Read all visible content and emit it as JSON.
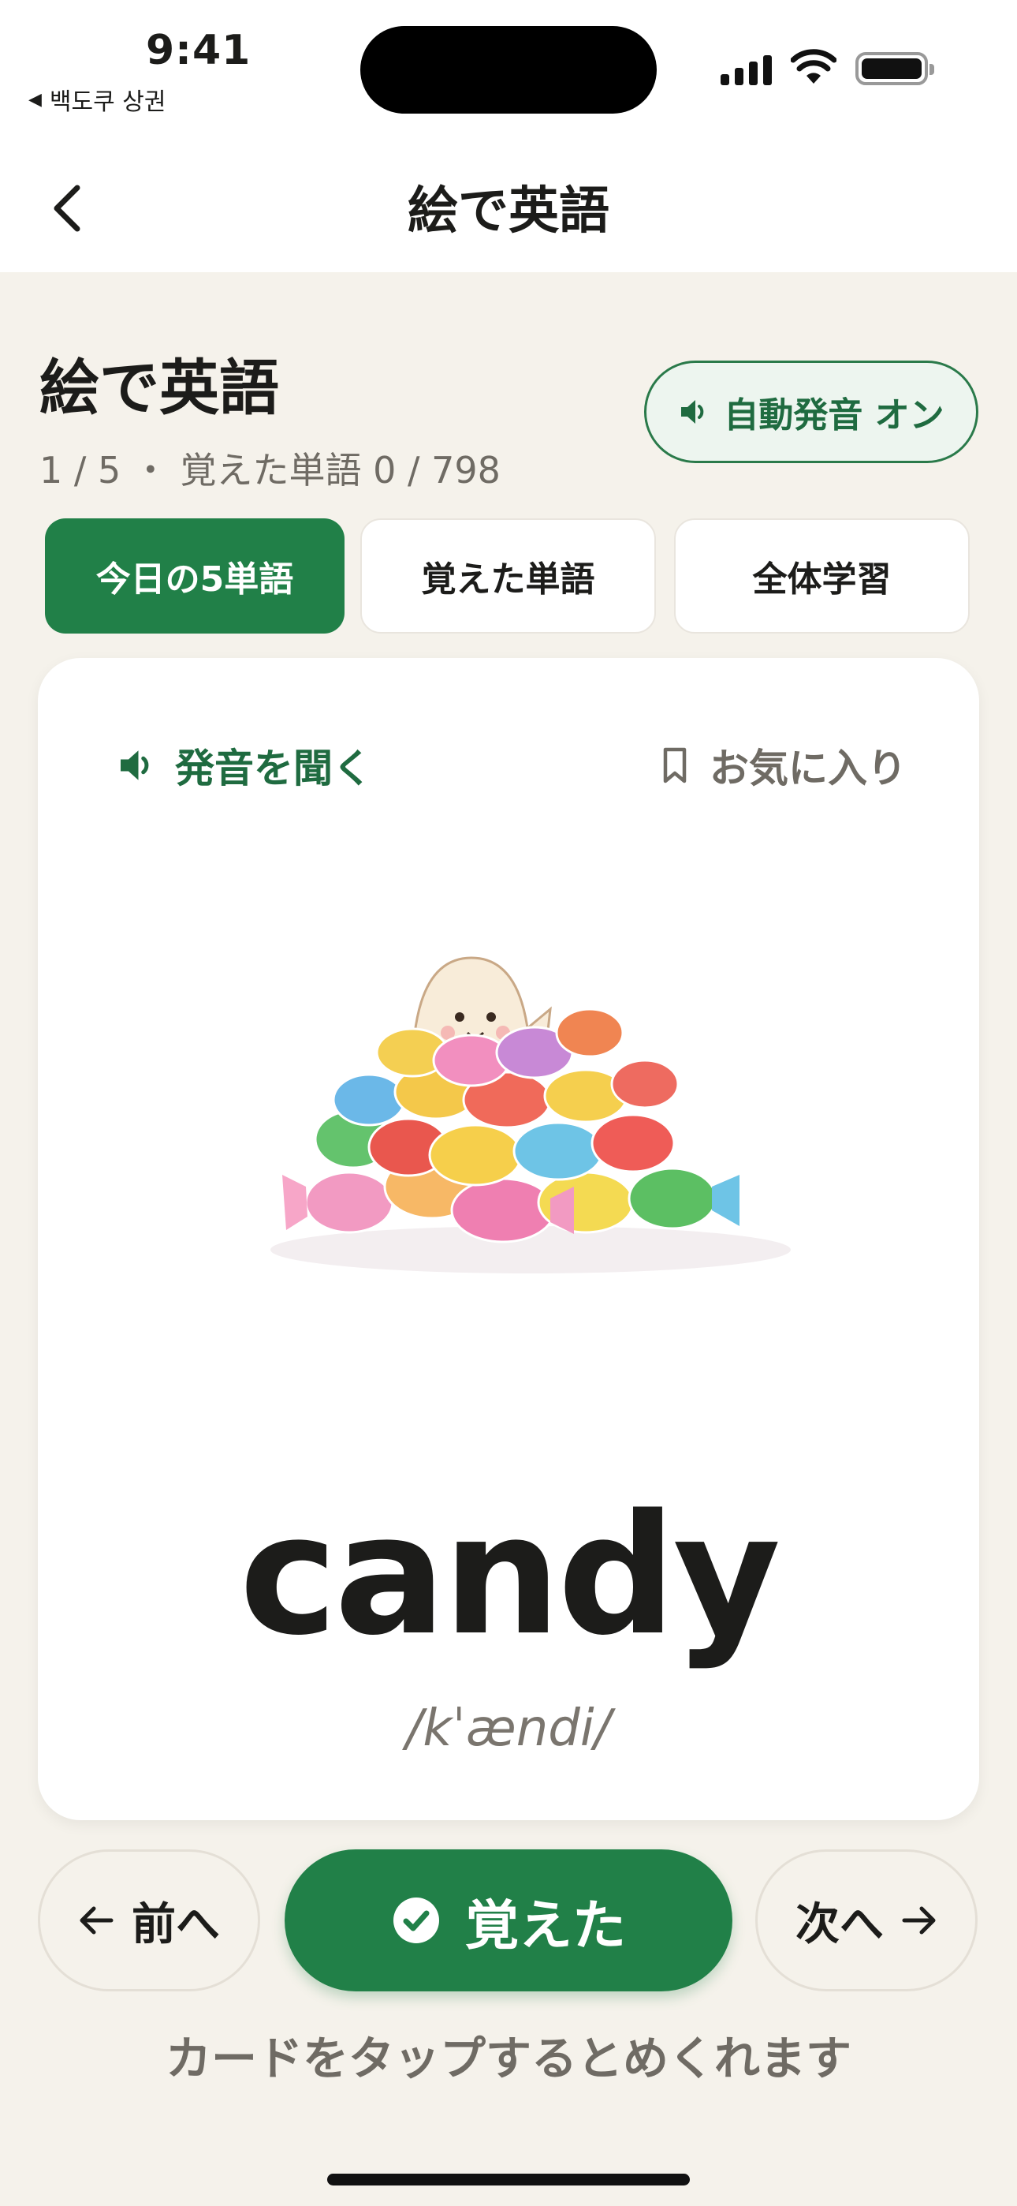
{
  "status_bar": {
    "time": "9:41",
    "back_app": "백도쿠 상권",
    "back_icon": "triangle-left-icon"
  },
  "nav": {
    "title": "絵で英語",
    "back_icon": "chevron-left-icon"
  },
  "header": {
    "title": "絵で英語",
    "progress": "1 / 5 ・ 覚えた単語 0 / 798",
    "auto_pronounce": {
      "label": "自動発音 オン",
      "icon": "speaker-icon",
      "state": "on"
    }
  },
  "tabs": [
    {
      "label": "今日の5単語",
      "active": true
    },
    {
      "label": "覚えた単語",
      "active": false
    },
    {
      "label": "全体学習",
      "active": false
    }
  ],
  "card": {
    "listen_label": "発音を聞く",
    "listen_icon": "speaker-icon",
    "favorite_label": "お気に入り",
    "favorite_icon": "bookmark-icon",
    "word": "candy",
    "phonetic": "/kˈændi/",
    "image": "illustration of a pile of colorful wrapped candies with a small cute creature"
  },
  "controls": {
    "prev_label": "前へ",
    "prev_icon": "arrow-left-icon",
    "learned_label": "覚えた",
    "learned_icon": "check-circle-icon",
    "next_label": "次へ",
    "next_icon": "arrow-right-icon"
  },
  "hint": "カードをタップするとめくれます",
  "colors": {
    "accent": "#218048",
    "background": "#f5f2eb",
    "card": "#ffffff",
    "muted_text": "#6f6b64"
  }
}
